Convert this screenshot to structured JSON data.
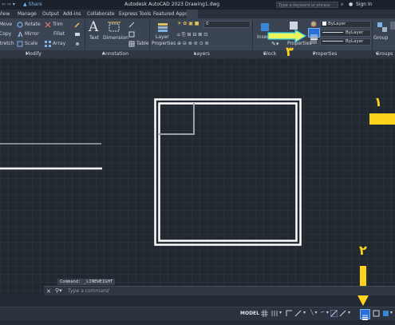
{
  "titlebar": {
    "share": "Share",
    "title": "Autodesk AutoCAD 2023    Drawing1.dwg",
    "search_placeholder": "Type a keyword or phrase",
    "sign_in": "Sign In"
  },
  "menu": {
    "items": [
      "View",
      "Manage",
      "Output",
      "Add-ins",
      "Collaborate",
      "Express Tools",
      "Featured Apps"
    ]
  },
  "ribbon": {
    "modify": {
      "move": "Move",
      "copy": "Copy",
      "stretch": "Stretch",
      "rotate": "Rotate",
      "mirror": "Mirror",
      "scale": "Scale",
      "trim": "Trim",
      "fillet": "Fillet",
      "array": "Array"
    },
    "annotation": {
      "text": "Text",
      "dimension": "Dimension",
      "table": "Table"
    },
    "layers": {
      "layer_properties_1": "Layer",
      "layer_properties_2": "Properties",
      "layer_value": "0"
    },
    "block": {
      "insert": "Insert"
    },
    "properties": {
      "properties_button": "Properties",
      "color": "ByLayer",
      "lineweight": "ByLayer",
      "linetype": "ByLayer"
    },
    "groups": {
      "group": "Group"
    },
    "panels": [
      "Modify",
      "Annotation",
      "Layers",
      "Block",
      "Properties",
      "Groups"
    ]
  },
  "command": {
    "history": "Command:  _LINEWEIGHT",
    "placeholder": "Type a command"
  },
  "status": {
    "model": "MODEL"
  },
  "annotations": {
    "one": "١",
    "two": "٢",
    "three": "٣"
  },
  "colors": {
    "accent_yellow": "#ffd21c",
    "arrow_fill": "#eef55a",
    "arrow_edge": "#2fd0e8",
    "highlight": "#2a6fd6"
  }
}
